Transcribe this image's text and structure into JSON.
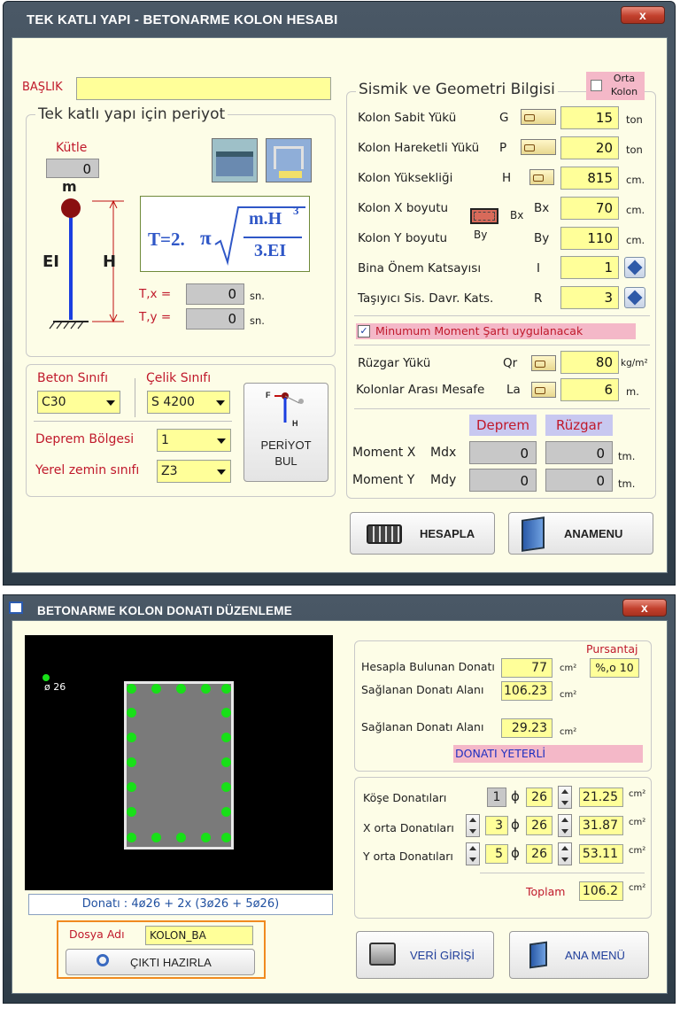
{
  "win1": {
    "title": "TEK KATLI YAPI  -  BETONARME KOLON HESABI",
    "close": "x",
    "baslik_label": "BAŞLIK",
    "baslik_value": "",
    "periyot": {
      "group_title": "Tek katlı yapı için periyot",
      "kutle_label": "Kütle",
      "kutle_value": "0",
      "m_label": "m",
      "ei_label": "EI",
      "h_label": "H",
      "formula_left": "T=2.",
      "formula_pi": "π",
      "formula_num": "m.H",
      "formula_exp": "3",
      "formula_den": "3.EI",
      "tx_label": "T,x =",
      "tx_value": "0",
      "ty_label": "T,y =",
      "ty_value": "0",
      "unit": "sn."
    },
    "materials": {
      "beton_label": "Beton Sınıfı",
      "beton_value": "C30",
      "celik_label": "Çelik Sınıfı",
      "celik_value": "S 4200",
      "deprem_label": "Deprem Bölgesi",
      "deprem_value": "1",
      "zemin_label": "Yerel zemin sınıfı",
      "zemin_value": "Z3",
      "periyot_btn_line1": "PERİYOT",
      "periyot_btn_line2": "BUL",
      "icon_f": "F",
      "icon_h": "H"
    },
    "sismik": {
      "title": "Sismik ve Geometri Bilgisi",
      "orta_kolon": "Orta Kolon",
      "rows": [
        {
          "label": "Kolon Sabit Yükü",
          "sym": "G",
          "value": "15",
          "unit": "ton"
        },
        {
          "label": "Kolon Hareketli Yükü",
          "sym": "P",
          "value": "20",
          "unit": "ton"
        },
        {
          "label": "Kolon Yüksekliği",
          "sym": "H",
          "value": "815",
          "unit": "cm."
        },
        {
          "label": "Kolon X boyutu",
          "sym": "Bx",
          "value": "70",
          "unit": "cm."
        },
        {
          "label": "Kolon Y boyutu",
          "sym": "By",
          "value": "110",
          "unit": "cm."
        },
        {
          "label": "Bina Önem Katsayısı",
          "sym": "I",
          "value": "1"
        },
        {
          "label": "Taşıyıcı Sis. Davr. Kats.",
          "sym": "R",
          "value": "3"
        }
      ],
      "bx_tag": "Bx",
      "by_tag": "By",
      "minimum_moment": "Minumum Moment Şartı uygulanacak",
      "minimum_checked": true,
      "ruzgar_label": "Rüzgar Yükü",
      "ruzgar_sym": "Qr",
      "ruzgar_value": "80",
      "ruzgar_unit": "kg/m²",
      "mesafe_label": "Kolonlar Arası Mesafe",
      "mesafe_sym": "La",
      "mesafe_value": "6",
      "mesafe_unit": "m.",
      "deprem_head": "Deprem",
      "ruzgar_head": "Rüzgar",
      "mx_label": "Moment X",
      "mx_sym": "Mdx",
      "mx_deprem": "0",
      "mx_ruzgar": "0",
      "my_label": "Moment Y",
      "my_sym": "Mdy",
      "my_deprem": "0",
      "my_ruzgar": "0",
      "tm": "tm."
    },
    "hesapla": "HESAPLA",
    "anamenu": "ANAMENU"
  },
  "win2": {
    "title": "BETONARME KOLON DONATI DÜZENLEME",
    "close": "x",
    "phi_label": "ø 26",
    "donati_summary": "Donatı : 4ø26 + 2x (3ø26 + 5ø26)",
    "dosya_label": "Dosya Adı",
    "dosya_value": "KOLON_BA",
    "cikti_btn": "ÇIKTI HAZIRLA",
    "calc": {
      "pursantaj_label": "Pursantaj",
      "pursantaj_value": "%,o 10",
      "hesap_label": "Hesapla Bulunan Donatı",
      "hesap_value": "77",
      "saglanan1_label": "Sağlanan Donatı Alanı",
      "saglanan1_value": "106.23",
      "saglanan2_label": "Sağlanan Donatı Alanı",
      "saglanan2_value": "29.23",
      "status": "DONATI YETERLİ",
      "unit": "cm²"
    },
    "rebar": {
      "phi": "ϕ",
      "kose_label": "Köşe  Donatıları",
      "kose_count": "1",
      "kose_dia": "26",
      "kose_area": "21.25",
      "xorta_label": "X orta Donatıları",
      "xorta_count": "3",
      "xorta_dia": "26",
      "xorta_area": "31.87",
      "yorta_label": "Y orta Donatıları",
      "yorta_count": "5",
      "yorta_dia": "26",
      "yorta_area": "53.11",
      "toplam_label": "Toplam",
      "toplam_value": "106.2",
      "unit": "cm²"
    },
    "veri_girisi": "VERİ GİRİŞİ",
    "ana_menu": "ANA MENÜ"
  },
  "colors": {
    "title_bar": "#3a4a58",
    "panel": "#fdfde7",
    "input_yellow": "#ffff99",
    "input_gray": "#c8c8c8",
    "label_red": "#c0192b",
    "pink": "#f4b8c8",
    "rebar_green": "#18e018"
  }
}
